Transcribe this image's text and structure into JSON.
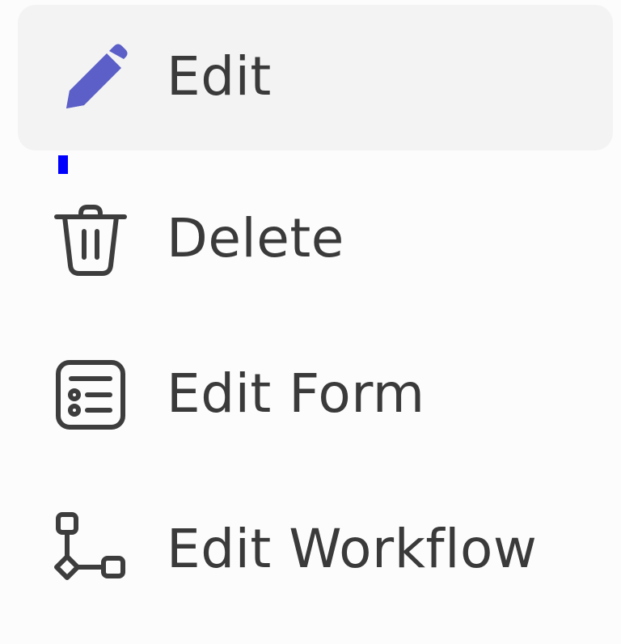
{
  "menu": {
    "items": [
      {
        "label": "Edit",
        "icon": "pencil-icon",
        "selected": true
      },
      {
        "label": "Delete",
        "icon": "trash-icon",
        "selected": false
      },
      {
        "label": "Edit Form",
        "icon": "form-icon",
        "selected": false
      },
      {
        "label": "Edit Workflow",
        "icon": "workflow-icon",
        "selected": false
      }
    ]
  },
  "colors": {
    "accent": "#5b5fc7",
    "hover_bg": "#f3f3f3",
    "text": "#3a3a3a",
    "icon_stroke": "#3d3d3d",
    "focus_indicator": "#0000ff",
    "menu_bg": "#fcfcfc"
  }
}
